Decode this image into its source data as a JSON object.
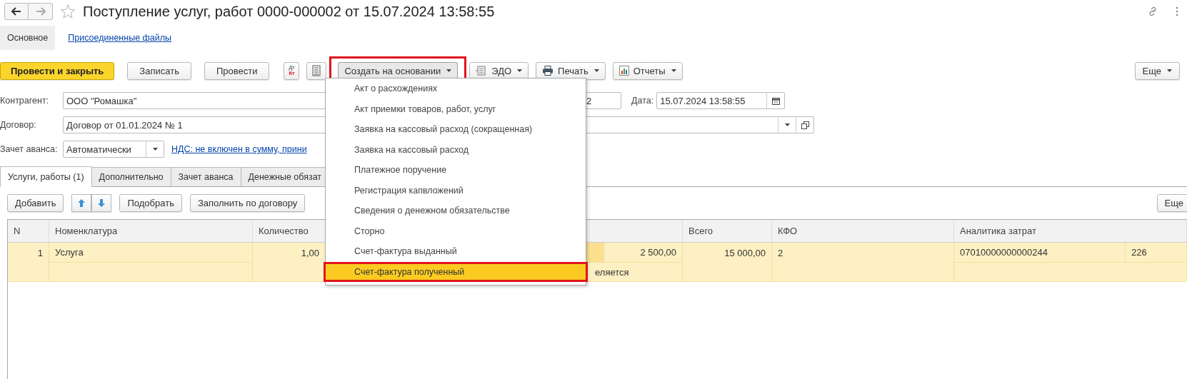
{
  "window": {
    "title": "Поступление услуг, работ 0000-000002 от 15.07.2024 13:58:55",
    "favorite": false
  },
  "form_tabs": [
    {
      "label": "Основное",
      "selected": true
    },
    {
      "label": "Присоединенные файлы",
      "selected": false
    }
  ],
  "toolbar": [
    {
      "kind": "primary",
      "label": "Провести и закрыть"
    },
    {
      "kind": "plain",
      "label": "Записать"
    },
    {
      "kind": "plain",
      "label": "Провести"
    },
    {
      "kind": "dtkt",
      "top": "Дт",
      "bottom": "Кт"
    },
    {
      "kind": "list"
    },
    {
      "kind": "menu",
      "label": "Создать на основании",
      "expanded": true,
      "outlined": true
    },
    {
      "kind": "edo",
      "label": "ЭДО"
    },
    {
      "kind": "print",
      "label": "Печать"
    },
    {
      "kind": "reports",
      "label": "Отчеты"
    }
  ],
  "toolbar_more": "Еще",
  "fields": {
    "counterparty": {
      "label": "Контрагент:",
      "value": "ООО \"Ромашка\""
    },
    "number": {
      "value": "2"
    },
    "date": {
      "label": "Дата:",
      "value": "15.07.2024 13:58:55"
    },
    "contract": {
      "label": "Договор:",
      "value": "Договор от 01.01.2024 № 1"
    },
    "advance": {
      "label": "Зачет аванса:",
      "value": "Автоматически"
    },
    "vat_link": "НДС: не включен в сумму, прини"
  },
  "tabs": [
    {
      "label": "Услуги, работы (1)",
      "selected": true
    },
    {
      "label": "Дополнительно",
      "selected": false
    },
    {
      "label": "Зачет аванса",
      "selected": false
    },
    {
      "label": "Денежные обязат",
      "selected": false
    }
  ],
  "table_toolbar": {
    "add": "Добавить",
    "pick": "Подобрать",
    "fill": "Заполнить по договору",
    "more": "Еще"
  },
  "table": {
    "columns": [
      "N",
      "Номенклатура",
      "Количество",
      "Всего",
      "КФО",
      "Аналитика затрат"
    ],
    "rows": [
      {
        "n": "1",
        "item": "Услуга",
        "quantity": "1,00",
        "price": "2 500,00",
        "total": "15 000,00",
        "kfo": "2",
        "analytics": "07010000000000244",
        "analytics_2": "226",
        "line_2": "еляется",
        "selected": true
      }
    ]
  },
  "menu": [
    {
      "label": "Акт о расхождениях",
      "selected": false,
      "outlined": false
    },
    {
      "label": "Акт приемки товаров, работ, услуг",
      "selected": false,
      "outlined": false
    },
    {
      "label": "Заявка на кассовый расход (сокращенная)",
      "selected": false,
      "outlined": false
    },
    {
      "label": "Заявка на кассовый расход",
      "selected": false,
      "outlined": false
    },
    {
      "label": "Платежное поручение",
      "selected": false,
      "outlined": false
    },
    {
      "label": "Регистрация капвложений",
      "selected": false,
      "outlined": false
    },
    {
      "label": "Сведения о денежном обязательстве",
      "selected": false,
      "outlined": false
    },
    {
      "label": "Сторно",
      "selected": false,
      "outlined": false
    },
    {
      "label": "Счет-фактура выданный",
      "selected": false,
      "outlined": false
    },
    {
      "label": "Счет-фактура полученный",
      "selected": true,
      "outlined": true
    }
  ]
}
